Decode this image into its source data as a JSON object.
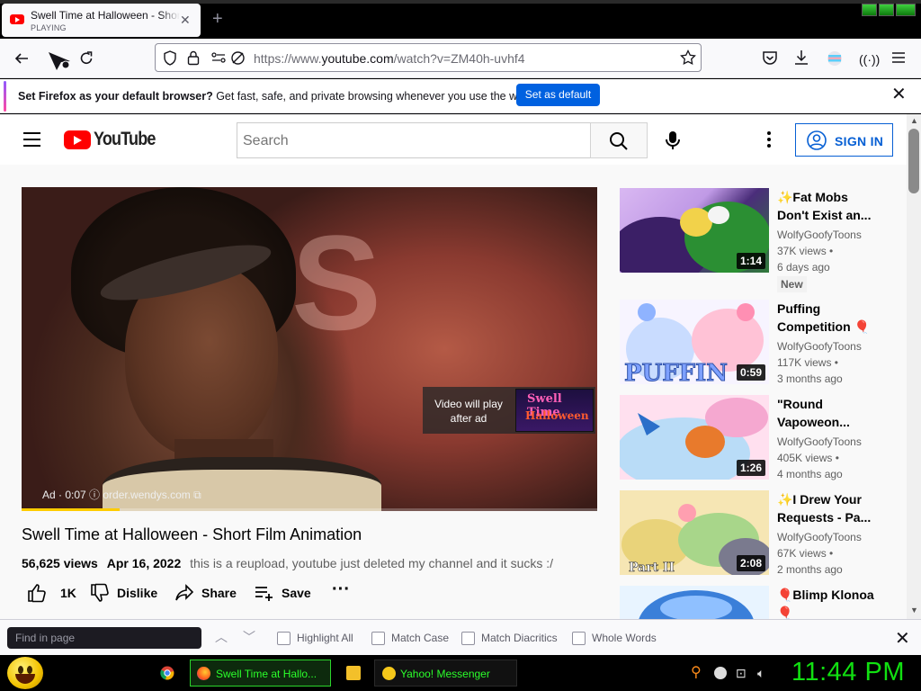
{
  "browser": {
    "tab": {
      "title": "Swell Time at Halloween - Short Film Animation",
      "status": "PLAYING"
    },
    "url": {
      "prefix": "https://www.",
      "domain": "youtube.com",
      "path": "/watch?v=ZM40h-uvhf4"
    },
    "notification": {
      "bold": "Set Firefox as your default browser?",
      "text": " Get fast, safe, and private browsing whenever you use the web.",
      "button": "Set as default"
    }
  },
  "youtube": {
    "logo_text": "YouTube",
    "search_placeholder": "Search",
    "sign_in": "SIGN IN",
    "player": {
      "ad_overlay": "Video will play after ad",
      "ad_thumb_line1": "Swell Time",
      "ad_thumb_line2": "Halloween",
      "ad_info": "Ad · 0:07 ⓘ   order.wendys.com ⧉",
      "ad_progress": 0.17
    },
    "video": {
      "title": "Swell Time at Halloween - Short Film Animation",
      "views": "56,625 views",
      "date": "Apr 16, 2022",
      "description": "this is a reupload, youtube just deleted my channel and it sucks :/",
      "like_count": "1K",
      "dislike": "Dislike",
      "share": "Share",
      "save": "Save"
    },
    "suggestions": [
      {
        "title": "✨Fat Mobs Don't Exist an...",
        "channel": "WolfyGoofyToons",
        "views": "37K views •",
        "age": "6 days ago",
        "duration": "1:14",
        "badge": "New"
      },
      {
        "title": "Puffing Competition 🎈",
        "channel": "WolfyGoofyToons",
        "views": "117K views •",
        "age": "3 months ago",
        "duration": "0:59"
      },
      {
        "title": "\"Round Vapoweon...",
        "channel": "WolfyGoofyToons",
        "views": "405K views •",
        "age": "4 months ago",
        "duration": "1:26"
      },
      {
        "title": "✨I Drew Your Requests - Pa...",
        "channel": "WolfyGoofyToons",
        "views": "67K views •",
        "age": "2 months ago",
        "duration": "2:08"
      },
      {
        "title": "🎈Blimp Klonoa 🎈",
        "channel": "",
        "views": "",
        "age": "",
        "duration": ""
      }
    ]
  },
  "findbar": {
    "placeholder": "Find in page",
    "highlight_all": "Highlight All",
    "match_case": "Match Case",
    "match_diacritics": "Match Diacritics",
    "whole_words": "Whole Words"
  },
  "taskbar": {
    "firefox_item": "Swell Time at Hallo...",
    "messenger_item": "Yahoo! Messenger",
    "clock": "11:44 PM"
  },
  "colors": {
    "yt_red": "#ff0000",
    "link_blue": "#065fd4",
    "firefox_blue": "#0061e0",
    "taskbar_green": "#11e011"
  }
}
